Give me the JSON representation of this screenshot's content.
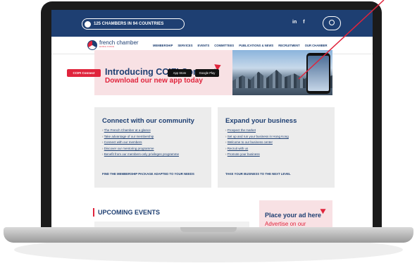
{
  "topbar": {
    "chambers_label": "125 CHAMBERS IN 94 COUNTRIES",
    "social": [
      "in",
      "f"
    ]
  },
  "logo": {
    "name": "french chamber",
    "tagline": "HONG KONG"
  },
  "menu": {
    "items": [
      "MEMBERSHIP",
      "SERVICES",
      "EVENTS",
      "COMMITTEES",
      "PUBLICATIONS & NEWS",
      "RECRUITMENT",
      "OUR CHAMBER"
    ]
  },
  "banner": {
    "title": "Introducing CCIFI Connect",
    "subtitle": "Download our new app today",
    "connect_label": "CCIFI Connect",
    "app_store": "App Store",
    "google_play": "Google Play"
  },
  "community": {
    "title": "Connect with our community",
    "links": [
      "The French Chamber at a glance",
      "Take advantage of our membership",
      "Connect with our members",
      "Discover our mentoring programme",
      "Benefit from our members-only privileges programme"
    ],
    "cta": "FIND THE MEMBERSHIP PACKAGE ADAPTED TO YOUR NEEDS"
  },
  "business": {
    "title": "Expand your business",
    "links": [
      "Prospect the market",
      "Set up and run your business in Hong Kong",
      "Welcome to our business center",
      "Recruit with us",
      "Promote your business"
    ],
    "cta": "TAKE YOUR BUSINESS TO THE NEXT LEVEL"
  },
  "events": {
    "title": "UPCOMING EVENTS"
  },
  "ad": {
    "title": "Place your ad here",
    "subtitle": "Advertise on our"
  },
  "colors": {
    "navy": "#1e3f72",
    "red": "#e0243c",
    "pink": "#f8e1e4",
    "panel_grey": "#ececec"
  }
}
